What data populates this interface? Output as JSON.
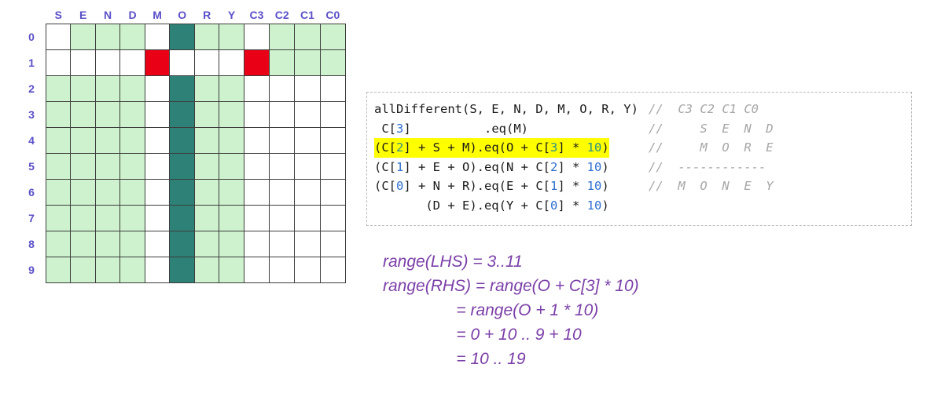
{
  "grid": {
    "column_headers": [
      "S",
      "E",
      "N",
      "D",
      "M",
      "O",
      "R",
      "Y",
      "C3",
      "C2",
      "C1",
      "C0"
    ],
    "row_headers": [
      "0",
      "1",
      "2",
      "3",
      "4",
      "5",
      "6",
      "7",
      "8",
      "9"
    ],
    "legend_colors": {
      "available": "#cdf2cd",
      "removed": "#ffffff",
      "assigned": "#2d8176",
      "pruned": "#ea0016",
      "header_text": "#5a50c8"
    },
    "cells": [
      [
        "white",
        "green",
        "green",
        "green",
        "white",
        "teal",
        "green",
        "green",
        "white",
        "green",
        "green",
        "green"
      ],
      [
        "white",
        "white",
        "white",
        "white",
        "red",
        "white",
        "white",
        "white",
        "red",
        "green",
        "green",
        "green"
      ],
      [
        "green",
        "green",
        "green",
        "green",
        "white",
        "teal",
        "green",
        "green",
        "white",
        "white",
        "white",
        "white"
      ],
      [
        "green",
        "green",
        "green",
        "green",
        "white",
        "teal",
        "green",
        "green",
        "white",
        "white",
        "white",
        "white"
      ],
      [
        "green",
        "green",
        "green",
        "green",
        "white",
        "teal",
        "green",
        "green",
        "white",
        "white",
        "white",
        "white"
      ],
      [
        "green",
        "green",
        "green",
        "green",
        "white",
        "teal",
        "green",
        "green",
        "white",
        "white",
        "white",
        "white"
      ],
      [
        "green",
        "green",
        "green",
        "green",
        "white",
        "teal",
        "green",
        "green",
        "white",
        "white",
        "white",
        "white"
      ],
      [
        "green",
        "green",
        "green",
        "green",
        "white",
        "teal",
        "green",
        "green",
        "white",
        "white",
        "white",
        "white"
      ],
      [
        "green",
        "green",
        "green",
        "green",
        "white",
        "teal",
        "green",
        "green",
        "white",
        "white",
        "white",
        "white"
      ],
      [
        "green",
        "green",
        "green",
        "green",
        "white",
        "teal",
        "green",
        "green",
        "white",
        "white",
        "white",
        "white"
      ]
    ]
  },
  "code": {
    "highlight_color": "#ffff00",
    "comment_color": "#a6a6a6",
    "number_color": "#2f6fd0",
    "lines": [
      {
        "id": "line-alldifferent",
        "highlighted": false,
        "segments": [
          {
            "text": "allDifferent(S, E, N, D, M, O, R, Y)",
            "kind": "code"
          }
        ],
        "comment": "//  C3 C2 C1 C0"
      },
      {
        "id": "line-c3-eq-m",
        "highlighted": false,
        "segments": [
          {
            "text": " C[",
            "kind": "code"
          },
          {
            "text": "3",
            "kind": "number"
          },
          {
            "text": "]          .eq(M)",
            "kind": "code"
          }
        ],
        "comment": "//     S  E  N  D"
      },
      {
        "id": "line-c2-s-m",
        "highlighted": true,
        "segments": [
          {
            "text": "(C[",
            "kind": "code"
          },
          {
            "text": "2",
            "kind": "number"
          },
          {
            "text": "] + S + M).eq(O + C[",
            "kind": "code"
          },
          {
            "text": "3",
            "kind": "number"
          },
          {
            "text": "] * ",
            "kind": "code"
          },
          {
            "text": "10",
            "kind": "number"
          },
          {
            "text": ")",
            "kind": "code"
          }
        ],
        "comment": "//     M  O  R  E"
      },
      {
        "id": "line-c1-e-o",
        "highlighted": false,
        "segments": [
          {
            "text": "(C[",
            "kind": "code"
          },
          {
            "text": "1",
            "kind": "number"
          },
          {
            "text": "] + E + O).eq(N + C[",
            "kind": "code"
          },
          {
            "text": "2",
            "kind": "number"
          },
          {
            "text": "] * ",
            "kind": "code"
          },
          {
            "text": "10",
            "kind": "number"
          },
          {
            "text": ")",
            "kind": "code"
          }
        ],
        "comment": "//  ------------"
      },
      {
        "id": "line-c0-n-r",
        "highlighted": false,
        "segments": [
          {
            "text": "(C[",
            "kind": "code"
          },
          {
            "text": "0",
            "kind": "number"
          },
          {
            "text": "] + N + R).eq(E + C[",
            "kind": "code"
          },
          {
            "text": "1",
            "kind": "number"
          },
          {
            "text": "] * ",
            "kind": "code"
          },
          {
            "text": "10",
            "kind": "number"
          },
          {
            "text": ")",
            "kind": "code"
          }
        ],
        "comment": "//  M  O  N  E  Y"
      },
      {
        "id": "line-d-e",
        "highlighted": false,
        "segments": [
          {
            "text": "       (D + E).eq(Y + C[",
            "kind": "code"
          },
          {
            "text": "0",
            "kind": "number"
          },
          {
            "text": "] * ",
            "kind": "code"
          },
          {
            "text": "10",
            "kind": "number"
          },
          {
            "text": ")",
            "kind": "code"
          }
        ],
        "comment": ""
      }
    ]
  },
  "range_derivation": {
    "text_color": "#7b3fa8",
    "lines": [
      "range(LHS) = 3..11",
      "range(RHS) = range(O + C[3] * 10)",
      "                = range(O + 1 * 10)",
      "                = 0 + 10 .. 9 + 10",
      "                = 10 .. 19"
    ]
  }
}
